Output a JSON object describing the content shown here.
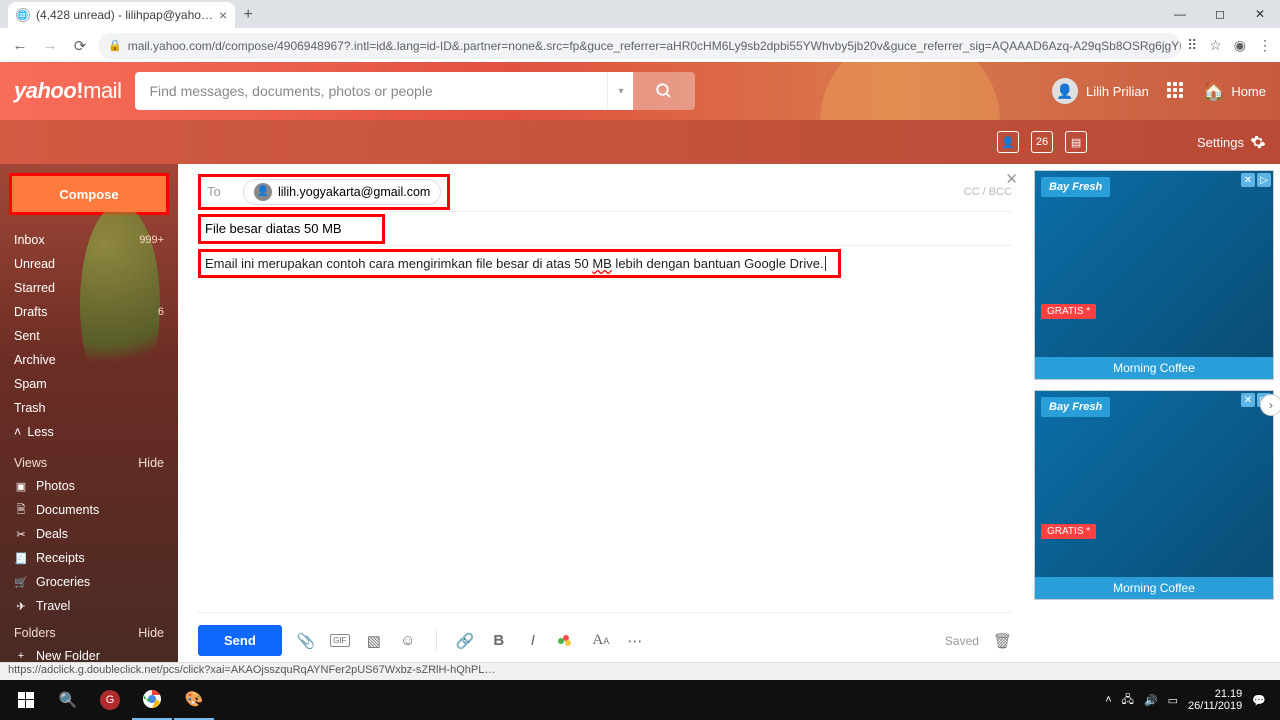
{
  "browser": {
    "tab_title": "(4,428 unread) - lilihpap@yaho…",
    "url": "mail.yahoo.com/d/compose/4906948967?.intl=id&.lang=id-ID&.partner=none&.src=fp&guce_referrer=aHR0cHM6Ly9sb2dpbi55YWhvby5jb20v&guce_referrer_sig=AQAAAD6Azq-A29qSb8OSRg6jgYHlhFH6YDN…",
    "status_url": "https://adclick.g.doubleclick.net/pcs/click?xai=AKAOjsszquRqAYNFer2pUS67Wxbz-sZRlH-hQhPL…"
  },
  "header": {
    "logo": "yahoo!mail",
    "search_placeholder": "Find messages, documents, photos or people",
    "user_name": "Lilih Prilian",
    "home": "Home"
  },
  "subheader": {
    "settings": "Settings"
  },
  "sidebar": {
    "compose": "Compose",
    "folders": [
      {
        "label": "Inbox",
        "badge": "999+"
      },
      {
        "label": "Unread",
        "badge": ""
      },
      {
        "label": "Starred",
        "badge": ""
      },
      {
        "label": "Drafts",
        "badge": "6"
      },
      {
        "label": "Sent",
        "badge": ""
      },
      {
        "label": "Archive",
        "badge": ""
      },
      {
        "label": "Spam",
        "badge": ""
      },
      {
        "label": "Trash",
        "badge": ""
      }
    ],
    "less": "Less",
    "views": "Views",
    "hide": "Hide",
    "smart": [
      {
        "label": "Photos"
      },
      {
        "label": "Documents"
      },
      {
        "label": "Deals"
      },
      {
        "label": "Receipts"
      },
      {
        "label": "Groceries"
      },
      {
        "label": "Travel"
      }
    ],
    "folders_label": "Folders",
    "new_folder": "New Folder"
  },
  "compose": {
    "to_label": "To",
    "recipient": "lilih.yogyakarta@gmail.com",
    "ccbcc": "CC / BCC",
    "subject": "File besar diatas 50 MB",
    "body_pre": "Email ini merupakan contoh cara mengirimkan file besar di atas 50 ",
    "body_wavy": "MB",
    "body_post": " lebih dengan bantuan Google Drive.",
    "send": "Send",
    "saved": "Saved"
  },
  "ads": {
    "brand": "Bay Fresh",
    "gratis": "GRATIS *",
    "caption": "Morning Coffee"
  },
  "taskbar": {
    "time": "21.19",
    "date": "26/11/2019"
  }
}
